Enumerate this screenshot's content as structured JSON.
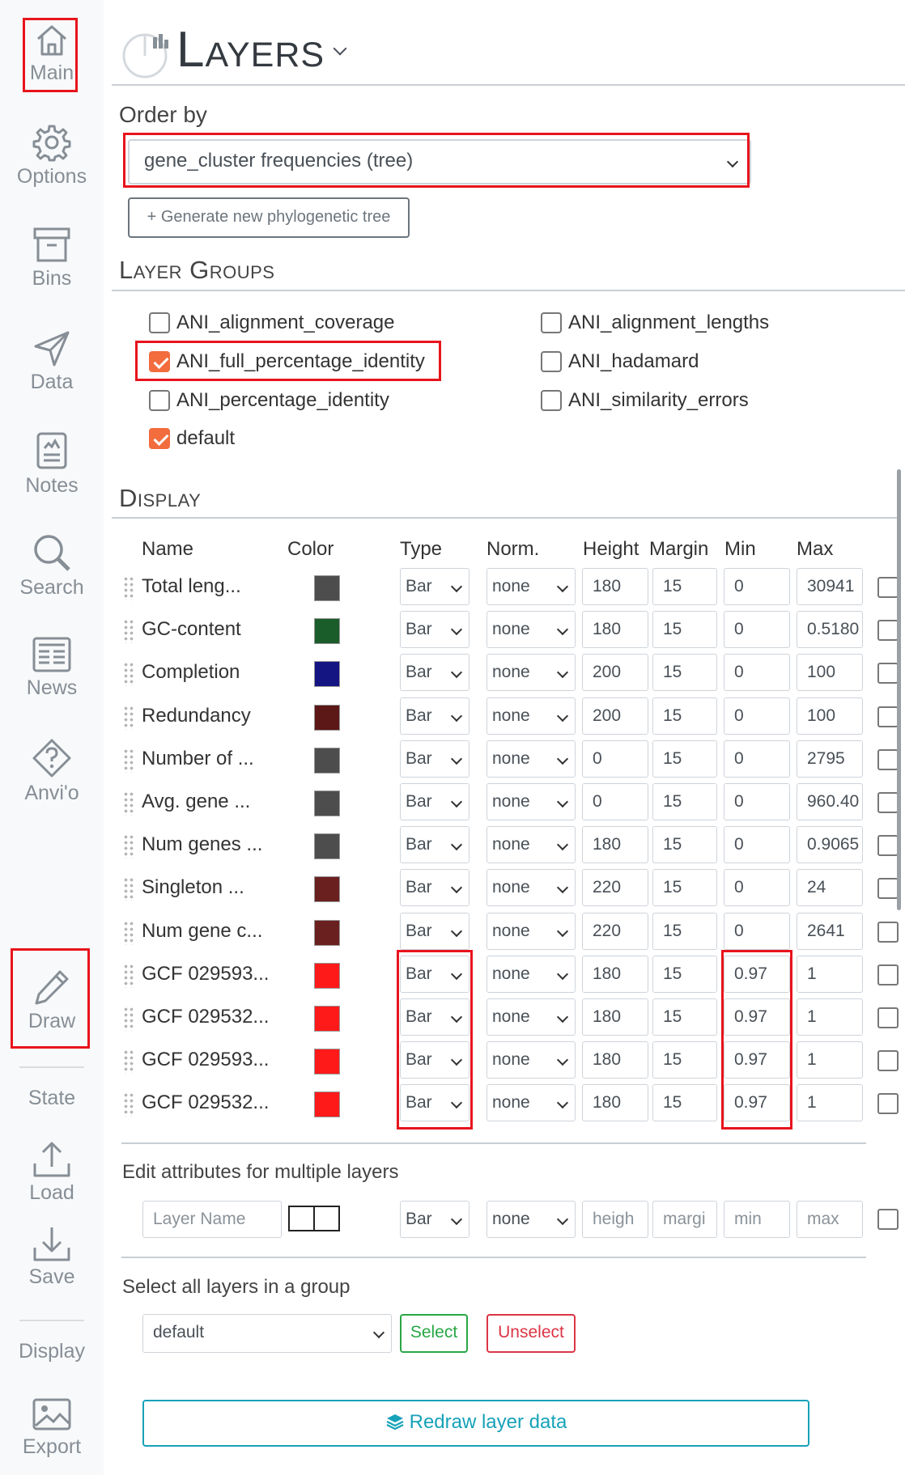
{
  "sidebar": {
    "items": [
      {
        "label": "Main",
        "icon": "home-icon"
      },
      {
        "label": "Options",
        "icon": "gear-icon"
      },
      {
        "label": "Bins",
        "icon": "archive-icon"
      },
      {
        "label": "Data",
        "icon": "send-icon"
      },
      {
        "label": "Notes",
        "icon": "notes-icon"
      },
      {
        "label": "Search",
        "icon": "search-icon"
      },
      {
        "label": "News",
        "icon": "newspaper-icon"
      },
      {
        "label": "Anvi'o",
        "icon": "help-icon"
      },
      {
        "label": "Draw",
        "icon": "pencil-icon"
      },
      {
        "label": "State"
      },
      {
        "label": "Load",
        "icon": "upload-icon"
      },
      {
        "label": "Save",
        "icon": "download-icon"
      },
      {
        "label": "Display"
      },
      {
        "label": "Export",
        "icon": "image-icon"
      }
    ]
  },
  "header": {
    "title": "Layers"
  },
  "order_by": {
    "label": "Order by",
    "value": "gene_cluster frequencies (tree)",
    "generate_button": "+ Generate new phylogenetic tree"
  },
  "layer_groups": {
    "title": "Layer Groups",
    "items": [
      {
        "label": "ANI_alignment_coverage",
        "checked": false
      },
      {
        "label": "ANI_alignment_lengths",
        "checked": false
      },
      {
        "label": "ANI_full_percentage_identity",
        "checked": true
      },
      {
        "label": "ANI_hadamard",
        "checked": false
      },
      {
        "label": "ANI_percentage_identity",
        "checked": false
      },
      {
        "label": "ANI_similarity_errors",
        "checked": false
      },
      {
        "label": "default",
        "checked": true
      }
    ]
  },
  "display": {
    "title": "Display",
    "columns": [
      "Name",
      "Color",
      "Type",
      "Norm.",
      "Height",
      "Margin",
      "Min",
      "Max"
    ],
    "rows": [
      {
        "name": "Total leng...",
        "color": "#4d4d4d",
        "type": "Bar",
        "norm": "none",
        "height": "180",
        "margin": "15",
        "min": "0",
        "max": "30941"
      },
      {
        "name": "GC-content",
        "color": "#1a5c2a",
        "type": "Bar",
        "norm": "none",
        "height": "180",
        "margin": "15",
        "min": "0",
        "max": "0.5180"
      },
      {
        "name": "Completion",
        "color": "#141483",
        "type": "Bar",
        "norm": "none",
        "height": "200",
        "margin": "15",
        "min": "0",
        "max": "100"
      },
      {
        "name": "Redundancy",
        "color": "#5c1717",
        "type": "Bar",
        "norm": "none",
        "height": "200",
        "margin": "15",
        "min": "0",
        "max": "100"
      },
      {
        "name": "Number of ...",
        "color": "#4d4d4d",
        "type": "Bar",
        "norm": "none",
        "height": "0",
        "margin": "15",
        "min": "0",
        "max": "2795"
      },
      {
        "name": "Avg. gene ...",
        "color": "#4d4d4d",
        "type": "Bar",
        "norm": "none",
        "height": "0",
        "margin": "15",
        "min": "0",
        "max": "960.40"
      },
      {
        "name": "Num genes ...",
        "color": "#4d4d4d",
        "type": "Bar",
        "norm": "none",
        "height": "180",
        "margin": "15",
        "min": "0",
        "max": "0.9065"
      },
      {
        "name": "Singleton ...",
        "color": "#6b2020",
        "type": "Bar",
        "norm": "none",
        "height": "220",
        "margin": "15",
        "min": "0",
        "max": "24"
      },
      {
        "name": "Num gene c...",
        "color": "#6b2020",
        "type": "Bar",
        "norm": "none",
        "height": "220",
        "margin": "15",
        "min": "0",
        "max": "2641"
      },
      {
        "name": "GCF 029593...",
        "color": "#ff1a1a",
        "type": "Bar",
        "norm": "none",
        "height": "180",
        "margin": "15",
        "min": "0.97",
        "max": "1"
      },
      {
        "name": "GCF 029532...",
        "color": "#ff1a1a",
        "type": "Bar",
        "norm": "none",
        "height": "180",
        "margin": "15",
        "min": "0.97",
        "max": "1"
      },
      {
        "name": "GCF 029593...",
        "color": "#ff1a1a",
        "type": "Bar",
        "norm": "none",
        "height": "180",
        "margin": "15",
        "min": "0.97",
        "max": "1"
      },
      {
        "name": "GCF 029532...",
        "color": "#ff1a1a",
        "type": "Bar",
        "norm": "none",
        "height": "180",
        "margin": "15",
        "min": "0.97",
        "max": "1"
      }
    ]
  },
  "multi_edit": {
    "title": "Edit attributes for multiple layers",
    "layer_name_placeholder": "Layer Name",
    "type": "Bar",
    "norm": "none",
    "height_placeholder": "heigh",
    "margin_placeholder": "margi",
    "min_placeholder": "min",
    "max_placeholder": "max"
  },
  "group_select": {
    "title": "Select all layers in a group",
    "value": "default",
    "select_button": "Select",
    "unselect_button": "Unselect"
  },
  "redraw_button": "Redraw layer data"
}
